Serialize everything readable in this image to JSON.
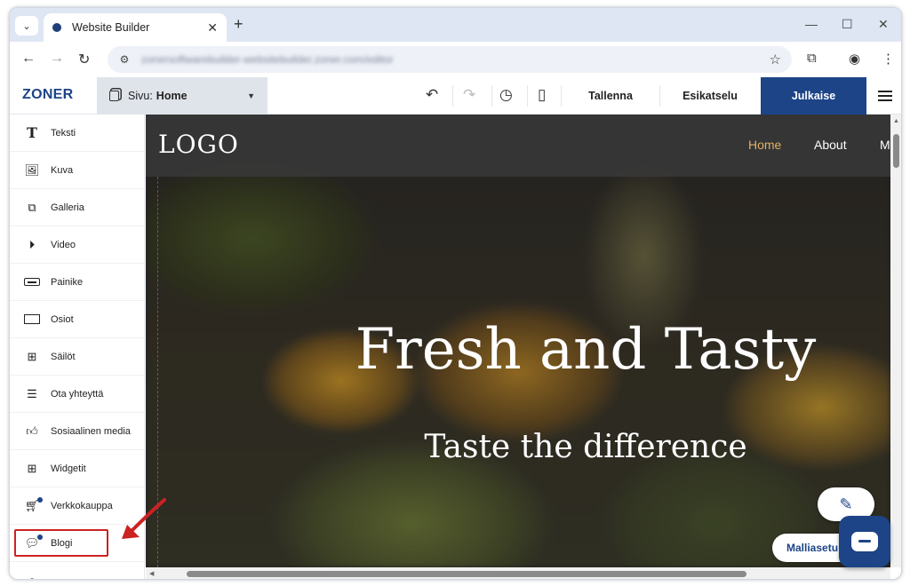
{
  "browser": {
    "tab_title": "Website Builder",
    "tab_menu_icon": "chevron-down-icon",
    "tab_close": "✕",
    "new_tab": "+",
    "minimize": "—",
    "maximize": "☐",
    "close": "✕",
    "url": "zonersoftwarebuilder-websitebuilder.zoner.com/editor"
  },
  "app": {
    "logo": "ZONER",
    "page_selector": {
      "prefix": "Sivu:",
      "name": "Home"
    },
    "save": "Tallenna",
    "preview": "Esikatselu",
    "publish": "Julkaise"
  },
  "sidebar": {
    "items": [
      {
        "label": "Teksti",
        "icon": "text-icon"
      },
      {
        "label": "Kuva",
        "icon": "image-icon"
      },
      {
        "label": "Galleria",
        "icon": "gallery-icon"
      },
      {
        "label": "Video",
        "icon": "play-icon"
      },
      {
        "label": "Painike",
        "icon": "button-icon"
      },
      {
        "label": "Osiot",
        "icon": "section-icon"
      },
      {
        "label": "Säilöt",
        "icon": "container-icon"
      },
      {
        "label": "Ota yhteyttä",
        "icon": "contact-form-icon"
      },
      {
        "label": "Sosiaalinen media",
        "icon": "thumbs-up-icon"
      },
      {
        "label": "Widgetit",
        "icon": "widgets-icon"
      },
      {
        "label": "Verkkokauppa",
        "icon": "cart-icon"
      },
      {
        "label": "Blogi",
        "icon": "blog-icon"
      }
    ]
  },
  "site": {
    "logo": "LOGO",
    "nav": [
      "Home",
      "About",
      "M"
    ],
    "active_nav": "Home",
    "hero_title": "Fresh and Tasty",
    "hero_subtitle": "Taste the difference"
  },
  "floating": {
    "style_settings": "Malliasetu"
  },
  "colors": {
    "brand": "#1c4487",
    "nav_active": "#e0b065",
    "highlight": "#cc2222"
  }
}
